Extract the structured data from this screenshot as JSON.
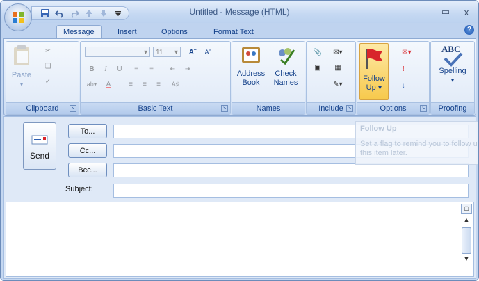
{
  "window": {
    "title": "Untitled - Message (HTML)",
    "controls": {
      "minimize": "–",
      "maximize": "▭",
      "close": "x"
    }
  },
  "quick_access": {
    "icons": [
      "save-icon",
      "undo-icon",
      "redo-icon",
      "prev-item-icon",
      "next-item-icon",
      "customize-qat-icon"
    ]
  },
  "tabs": [
    "Message",
    "Insert",
    "Options",
    "Format Text"
  ],
  "active_tab": "Message",
  "help_label": "?",
  "ribbon": {
    "clipboard": {
      "label": "Clipboard",
      "paste": "Paste"
    },
    "basic_text": {
      "label": "Basic Text",
      "font_size": "11"
    },
    "names": {
      "label": "Names",
      "address_book_1": "Address",
      "address_book_2": "Book",
      "check_names_1": "Check",
      "check_names_2": "Names"
    },
    "include": {
      "label": "Include"
    },
    "options": {
      "label": "Options",
      "follow_up_1": "Follow",
      "follow_up_2": "Up"
    },
    "proofing": {
      "label": "Proofing",
      "spelling": "Spelling",
      "spelling_icon_text": "ABC"
    }
  },
  "compose": {
    "send_label": "Send",
    "to_label": "To...",
    "cc_label": "Cc...",
    "bcc_label": "Bcc...",
    "subject_label": "Subject:",
    "to_value": "",
    "cc_value": "",
    "bcc_value": "",
    "subject_value": ""
  },
  "tooltip": {
    "title": "Follow Up",
    "body": "Set a flag to remind you to follow up on this item later."
  },
  "colors": {
    "accent": "#15428b",
    "frame": "#c4d7f1",
    "follow_up_highlight": "#f7c94c",
    "flag": "#d8262b"
  }
}
